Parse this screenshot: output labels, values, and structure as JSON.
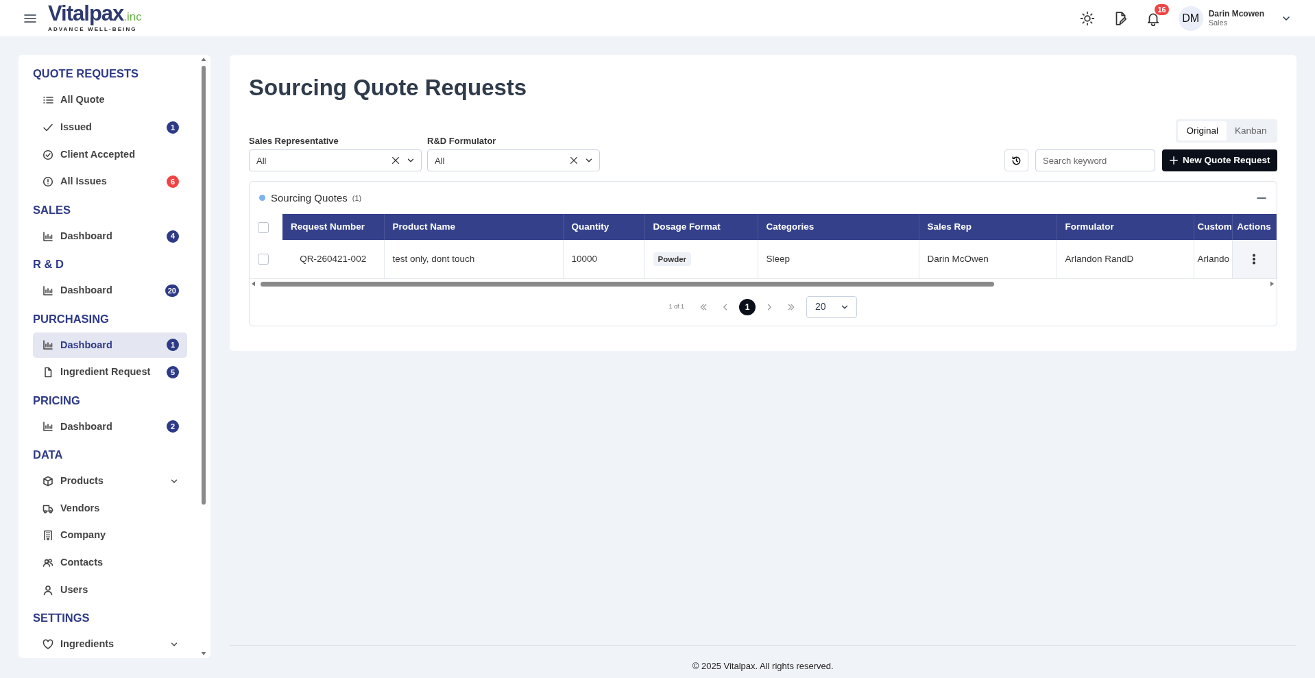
{
  "header": {
    "logo": {
      "name": "Vitalpax",
      "suffix": ".inc",
      "tagline": "ADVANCE WELL-BEING"
    },
    "notifications": "16",
    "user": {
      "initials": "DM",
      "name": "Darin Mcowen",
      "role": "Sales"
    }
  },
  "sidebar": {
    "sections": [
      {
        "title": "QUOTE REQUESTS",
        "items": [
          {
            "label": "All Quote",
            "kind": "link",
            "selected": false
          },
          {
            "label": "Issued",
            "kind": "link",
            "badge": "1",
            "color": "#2e3a87",
            "selected": false
          },
          {
            "label": "Client Accepted",
            "kind": "link",
            "selected": false
          },
          {
            "label": "All Issues",
            "kind": "link",
            "badge": "6",
            "color": "#ef4444",
            "selected": false
          }
        ]
      },
      {
        "title": "SALES",
        "items": [
          {
            "label": "Dashboard",
            "kind": "link",
            "badge": "4",
            "color": "#2e3a87",
            "selected": false
          }
        ]
      },
      {
        "title": "R & D",
        "items": [
          {
            "label": "Dashboard",
            "kind": "link",
            "badge": "20",
            "color": "#2e3a87",
            "selected": false
          }
        ]
      },
      {
        "title": "PURCHASING",
        "items": [
          {
            "label": "Dashboard",
            "kind": "link",
            "badge": "1",
            "color": "#2e3a87",
            "selected": true
          },
          {
            "label": "Ingredient Request",
            "kind": "link",
            "badge": "5",
            "color": "#2e3a87",
            "selected": false
          }
        ]
      },
      {
        "title": "PRICING",
        "items": [
          {
            "label": "Dashboard",
            "kind": "link",
            "badge": "2",
            "color": "#2e3a87",
            "selected": false
          }
        ]
      },
      {
        "title": "DATA",
        "items": [
          {
            "label": "Products",
            "kind": "group",
            "selected": false
          },
          {
            "label": "Vendors",
            "kind": "link",
            "selected": false
          },
          {
            "label": "Company",
            "kind": "link",
            "selected": false
          },
          {
            "label": "Contacts",
            "kind": "link",
            "selected": false
          },
          {
            "label": "Users",
            "kind": "link",
            "selected": false
          }
        ]
      },
      {
        "title": "SETTINGS",
        "items": [
          {
            "label": "Ingredients",
            "kind": "group",
            "selected": false
          }
        ]
      }
    ]
  },
  "page": {
    "title": "Sourcing Quote Requests",
    "filters": [
      {
        "label": "Sales Representative",
        "value": "All"
      },
      {
        "label": "R&D Formulator",
        "value": "All"
      }
    ],
    "views": [
      {
        "label": "Original",
        "selected": true
      },
      {
        "label": "Kanban",
        "selected": false
      }
    ],
    "search": {
      "placeholder": "Search keyword"
    },
    "new_button": "New Quote Request"
  },
  "table": {
    "title": "Sourcing Quotes",
    "count": "(1)",
    "all_checked": false,
    "columns": [
      {
        "label": "Request Number",
        "kind": "text"
      },
      {
        "label": "Product Name",
        "kind": "text"
      },
      {
        "label": "Quantity",
        "kind": "text"
      },
      {
        "label": "Dosage Format",
        "kind": "tag"
      },
      {
        "label": "Categories",
        "kind": "text"
      },
      {
        "label": "Sales Rep",
        "kind": "text"
      },
      {
        "label": "Formulator",
        "kind": "text"
      },
      {
        "label": "Custom",
        "kind": "text"
      },
      {
        "label": "Actions",
        "kind": "actions"
      }
    ],
    "rows": [
      {
        "checked": false,
        "cells": [
          "QR-260421-002",
          "test only, dont touch",
          "10000",
          "Powder",
          "Sleep",
          "Darin McOwen",
          "Arlandon RandD",
          "Arlando"
        ]
      }
    ],
    "pagination": {
      "summary": "1 of 1",
      "pages": [
        {
          "label": "1",
          "selected": true
        }
      ],
      "page_size": "20"
    }
  },
  "footer": "© 2025 Vitalpax. All rights reserved."
}
